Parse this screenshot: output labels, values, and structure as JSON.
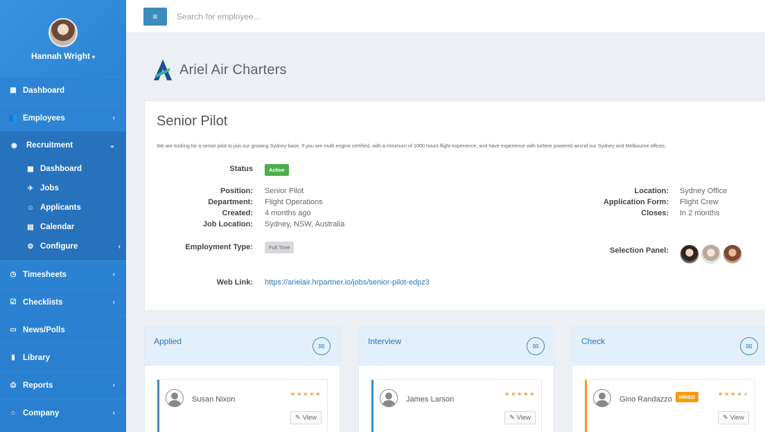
{
  "user": {
    "name": "Hannah Wright",
    "caret": "▾"
  },
  "sidebar": {
    "items_top": [
      {
        "label": "Dashboard",
        "icon": "th-large-icon",
        "glyph": "▦",
        "chev": ""
      },
      {
        "label": "Employees",
        "icon": "users-icon",
        "glyph": "👥",
        "chev": "‹"
      }
    ],
    "recruitment": {
      "label": "Recruitment",
      "icon": "eye-icon",
      "glyph": "◉",
      "chev": "⌄",
      "sub": [
        {
          "label": "Dashboard",
          "icon": "th-large-icon",
          "glyph": "▦",
          "chev": ""
        },
        {
          "label": "Jobs",
          "icon": "plane-icon",
          "glyph": "✈",
          "chev": ""
        },
        {
          "label": "Applicants",
          "icon": "user-icon",
          "glyph": "☺",
          "chev": ""
        },
        {
          "label": "Calendar",
          "icon": "calendar-icon",
          "glyph": "▤",
          "chev": ""
        },
        {
          "label": "Configure",
          "icon": "gear-icon",
          "glyph": "⚙",
          "chev": "‹"
        }
      ]
    },
    "items_bottom": [
      {
        "label": "Timesheets",
        "icon": "clock-icon",
        "glyph": "◷",
        "chev": "‹"
      },
      {
        "label": "Checklists",
        "icon": "check-square-icon",
        "glyph": "☑",
        "chev": "‹"
      },
      {
        "label": "News/Polls",
        "icon": "newspaper-icon",
        "glyph": "▭",
        "chev": ""
      },
      {
        "label": "Library",
        "icon": "file-icon",
        "glyph": "▮",
        "chev": ""
      },
      {
        "label": "Reports",
        "icon": "print-icon",
        "glyph": "⎙",
        "chev": "‹"
      },
      {
        "label": "Company",
        "icon": "bank-icon",
        "glyph": "⌂",
        "chev": "‹"
      }
    ]
  },
  "topbar": {
    "menu_glyph": "≡",
    "search_placeholder": "Search for employee..."
  },
  "company": {
    "name": "Ariel Air Charters"
  },
  "job": {
    "title": "Senior Pilot",
    "description": "We are looking for a senior pilot to join our growing Sydney base. If you are multi engine certified, with a minimum of 1000 hours flight experience, and have experience with turbine powered aircraf our Sydney and Melbourne offices.",
    "status_label": "Status",
    "status_value": "Active",
    "position_label": "Position:",
    "position_value": "Senior Pilot",
    "department_label": "Department:",
    "department_value": "Flight Operations",
    "created_label": "Created:",
    "created_value": "4 months ago",
    "job_location_label": "Job Location:",
    "job_location_value": "Sydney, NSW, Australia",
    "location_label": "Location:",
    "location_value": "Sydney Office",
    "application_form_label": "Application Form:",
    "application_form_value": "Flight Crew",
    "closes_label": "Closes:",
    "closes_value": "In 2 months",
    "employment_type_label": "Employment Type:",
    "employment_type_value": "Full Time",
    "selection_panel_label": "Selection Panel:",
    "web_link_label": "Web Link:",
    "web_link_value": "https://arielair.hrpartner.io/jobs/senior-pilot-edpz3"
  },
  "columns": [
    {
      "title": "Applied",
      "candidate": "Susan Nixon",
      "stars_on": "★★★★★",
      "stars_off": "",
      "hired": "",
      "view": "✎ View"
    },
    {
      "title": "Interview",
      "candidate": "James Larson",
      "stars_on": "★★★★★",
      "stars_off": "",
      "hired": "",
      "view": "✎ View"
    },
    {
      "title": "Check",
      "candidate": "Gino Randazzo",
      "stars_on": "★★★★",
      "stars_off": "★",
      "hired": "HIRED",
      "view": "✎ View"
    }
  ],
  "colors": {
    "sidebar": "#2f86d6",
    "accent": "#3c8dbc",
    "success": "#4cae4c",
    "warning": "#f39c12",
    "column_header": "#e3f0fb"
  }
}
